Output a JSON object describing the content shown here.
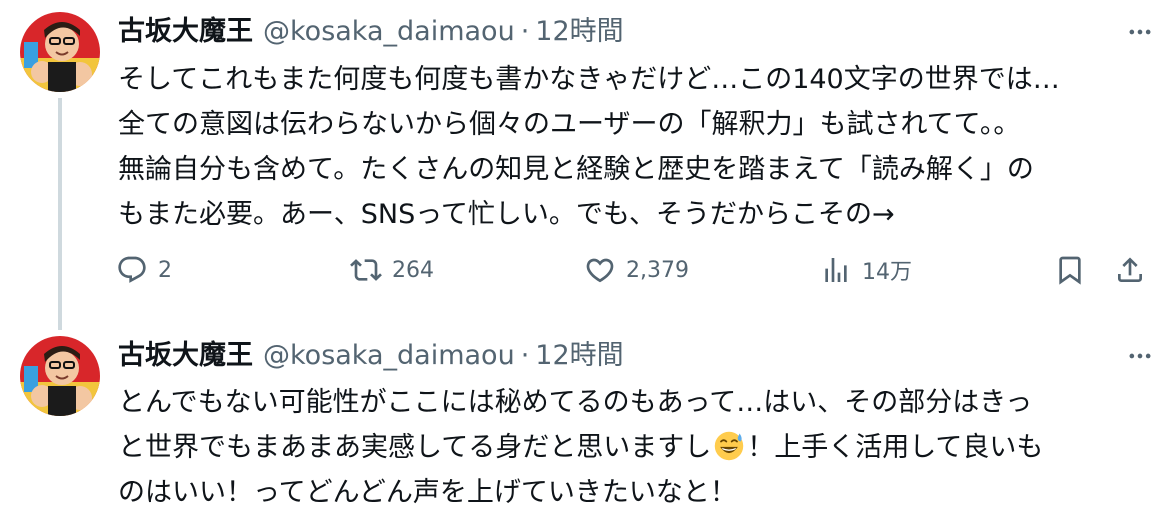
{
  "tweets": [
    {
      "author": {
        "name": "古坂大魔王",
        "handle": "@kosaka_daimaou"
      },
      "separator": "·",
      "time": "12時間",
      "lines": [
        "そしてこれもまた何度も何度も書かなきゃだけど…この140文字の世界では…",
        "全ての意図は伝わらないから個々のユーザーの「解釈力」も試されてて。。",
        "無論自分も含めて。たくさんの知見と経験と歴史を踏まえて「読み解く」の",
        "もまた必要。あー、SNSって忙しい。でも、そうだからこその→"
      ],
      "actions": {
        "reply_count": "2",
        "retweet_count": "264",
        "like_count": "2,379",
        "view_count": "14万"
      }
    },
    {
      "author": {
        "name": "古坂大魔王",
        "handle": "@kosaka_daimaou"
      },
      "separator": "·",
      "time": "12時間",
      "lines": [
        "とんでもない可能性がここには秘めてるのもあって…はい、その部分はきっ",
        {
          "before": "と世界でもまあまあ実感してる身だと思いますし",
          "emoji": "grinning-sweat-emoji",
          "after": "！上手く活用して良いも"
        },
        "のはいい！ってどんどん声を上げていきたいなと！"
      ]
    }
  ],
  "colors": {
    "text": "#0f1419",
    "secondary": "#536471",
    "thread_line": "#cfd9de"
  },
  "icons": [
    "more-icon",
    "reply-icon",
    "retweet-icon",
    "like-icon",
    "views-icon",
    "bookmark-icon",
    "share-icon"
  ]
}
